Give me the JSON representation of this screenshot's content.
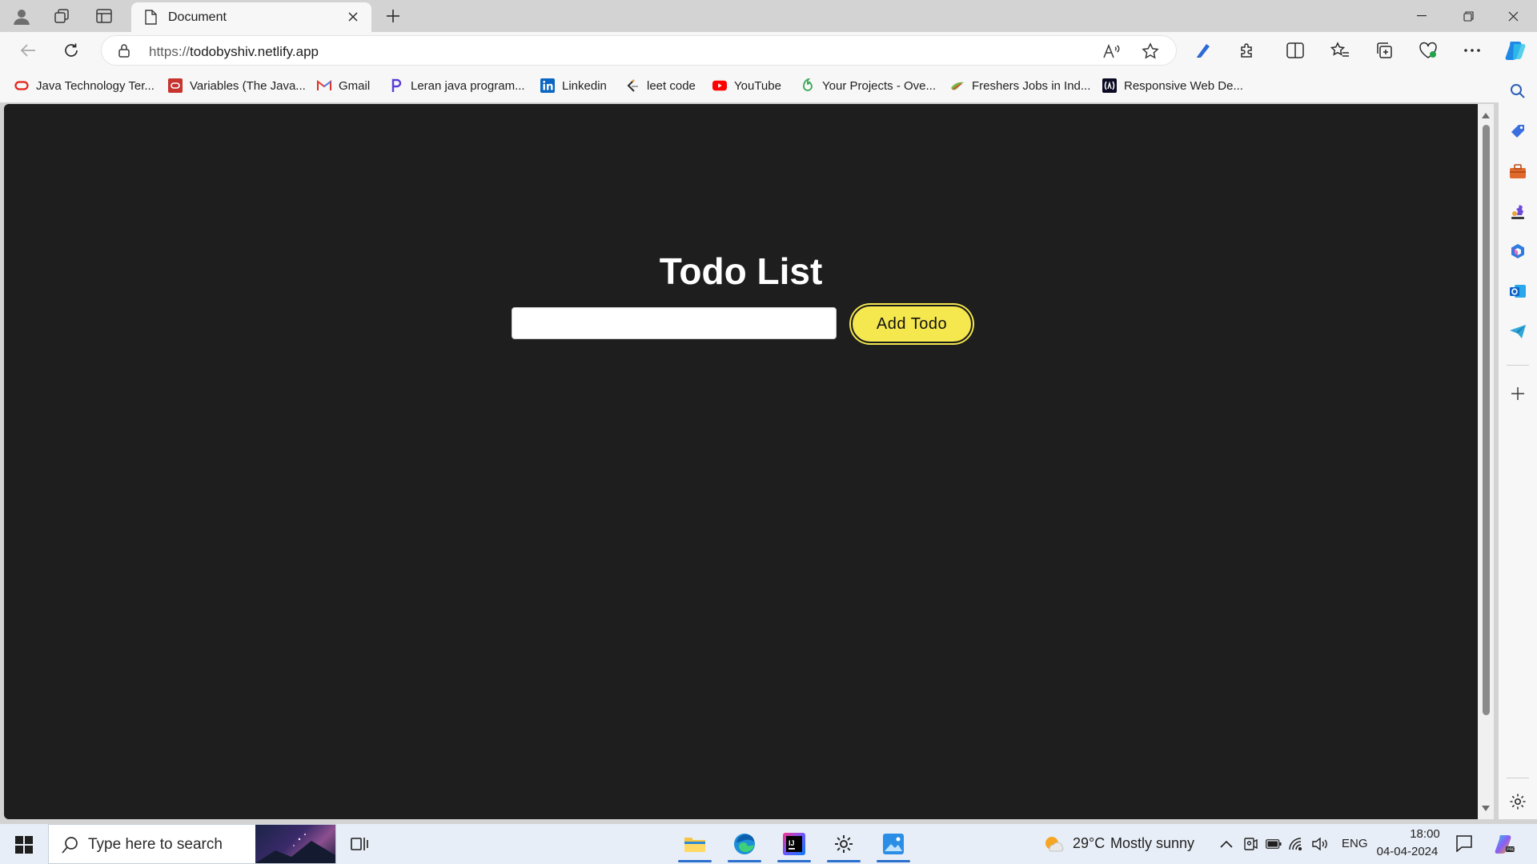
{
  "browser": {
    "tab": {
      "title": "Document"
    },
    "address": {
      "scheme": "https://",
      "host": "todobyshiv.netlify.app"
    },
    "bookmarks": [
      {
        "label": "Java Technology Ter...",
        "icon": "oracle-icon",
        "color": "#e2231a"
      },
      {
        "label": "Variables (The Java...",
        "icon": "oracle-box-icon",
        "color": "#c7332f"
      },
      {
        "label": "Gmail",
        "icon": "gmail-icon",
        "color": "#d93025"
      },
      {
        "label": "Leran java program...",
        "icon": "bookmark-p-icon",
        "color": "#5b3bd6"
      },
      {
        "label": "Linkedin",
        "icon": "linkedin-icon",
        "color": "#0a66c2"
      },
      {
        "label": "leet code",
        "icon": "leetcode-icon",
        "color": "#f89f1b"
      },
      {
        "label": "YouTube",
        "icon": "youtube-icon",
        "color": "#ff0000"
      },
      {
        "label": "Your Projects - Ove...",
        "icon": "projects-icon",
        "color": "#3aa757"
      },
      {
        "label": "Freshers Jobs in Ind...",
        "icon": "jobs-icon",
        "color": "#7cb342"
      },
      {
        "label": "Responsive Web De...",
        "icon": "freecodecamp-icon",
        "color": "#0a0a23"
      }
    ]
  },
  "page": {
    "title": "Todo List",
    "input": {
      "value": "",
      "placeholder": ""
    },
    "add_button": "Add Todo",
    "accent": "#f5e84e",
    "background": "#1e1e1f"
  },
  "taskbar": {
    "search_placeholder": "Type here to search",
    "weather": {
      "temp": "29°C",
      "condition": "Mostly sunny"
    },
    "language": "ENG",
    "time": "18:00",
    "date": "04-04-2024"
  }
}
